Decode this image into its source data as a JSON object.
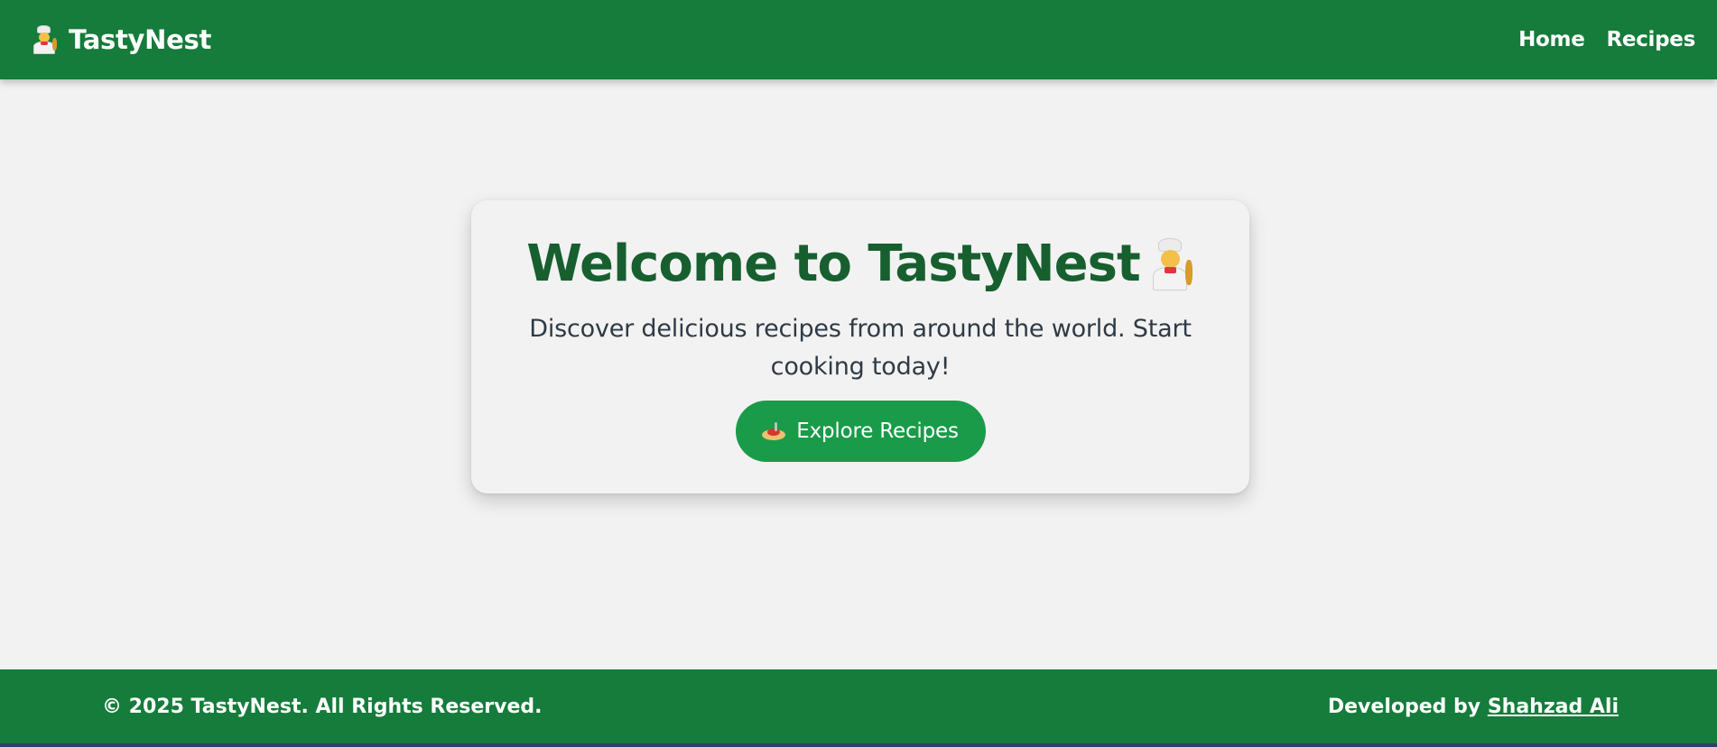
{
  "header": {
    "brand_icon": "chef-icon",
    "brand_name": "TastyNest",
    "nav": [
      {
        "label": "Home"
      },
      {
        "label": "Recipes"
      }
    ]
  },
  "hero": {
    "title": "Welcome to TastyNest",
    "title_icon": "chef-icon",
    "subtitle": "Discover delicious recipes from around the world. Start cooking today!",
    "cta_icon": "pasta-icon",
    "cta_label": "Explore Recipes"
  },
  "footer": {
    "copyright": "© 2025 TastyNest. All Rights Reserved.",
    "developed_by_prefix": "Developed by",
    "developer_name": "Shahzad Ali"
  },
  "colors": {
    "primary_green": "#157c3b",
    "button_green": "#1a9b49",
    "title_green": "#175f2f",
    "background": "#f2f2f2",
    "text_dark": "#2f3a45"
  }
}
